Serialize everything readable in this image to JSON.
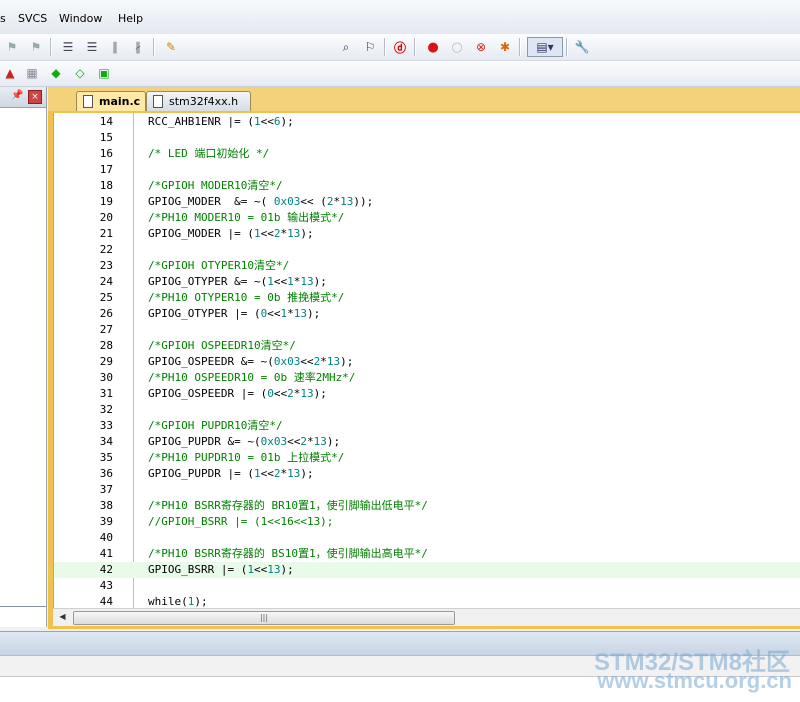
{
  "menu": [
    "s",
    "SVCS",
    "Window",
    "Help"
  ],
  "colors": {
    "comment": "#008000",
    "number": "#008080",
    "highlight": "#e8fbe8",
    "tab_active": "#ffe9a8"
  },
  "tabs": [
    {
      "label": "main.c",
      "active": true
    },
    {
      "label": "stm32f4xx.h",
      "active": false
    }
  ],
  "toolbar": {
    "find_value": "",
    "icons": [
      "indent-icon",
      "unindent-icon",
      "comment-icon",
      "uncomment-icon",
      "find-in-files-icon",
      "find-icon",
      "debug-icon",
      "breakpoint-icon",
      "disable-breakpoint-icon",
      "clear-breakpoints-icon",
      "kill-breakpoints-icon",
      "window-icon",
      "configure-icon"
    ]
  },
  "code": [
    {
      "n": "14",
      "parts": [
        [
          "t",
          "RCC_AHB1ENR |= ("
        ],
        [
          "n",
          "1"
        ],
        [
          "t",
          "<<"
        ],
        [
          "n",
          "6"
        ],
        [
          "t",
          ");"
        ]
      ]
    },
    {
      "n": "15",
      "parts": []
    },
    {
      "n": "16",
      "parts": [
        [
          "c",
          "/* LED 端口初始化 */"
        ]
      ]
    },
    {
      "n": "17",
      "parts": []
    },
    {
      "n": "18",
      "parts": [
        [
          "c",
          "/*GPIOH MODER10清空*/"
        ]
      ]
    },
    {
      "n": "19",
      "parts": [
        [
          "t",
          "GPIOG_MODER  &= ~( "
        ],
        [
          "n",
          "0x03"
        ],
        [
          "t",
          "<< ("
        ],
        [
          "n",
          "2"
        ],
        [
          "t",
          "*"
        ],
        [
          "n",
          "13"
        ],
        [
          "t",
          "));"
        ]
      ]
    },
    {
      "n": "20",
      "parts": [
        [
          "c",
          "/*PH10 MODER10 = 01b 输出模式*/"
        ]
      ]
    },
    {
      "n": "21",
      "parts": [
        [
          "t",
          "GPIOG_MODER |= ("
        ],
        [
          "n",
          "1"
        ],
        [
          "t",
          "<<"
        ],
        [
          "n",
          "2"
        ],
        [
          "t",
          "*"
        ],
        [
          "n",
          "13"
        ],
        [
          "t",
          ");"
        ]
      ]
    },
    {
      "n": "22",
      "parts": []
    },
    {
      "n": "23",
      "parts": [
        [
          "c",
          "/*GPIOH OTYPER10清空*/"
        ]
      ]
    },
    {
      "n": "24",
      "parts": [
        [
          "t",
          "GPIOG_OTYPER &= ~("
        ],
        [
          "n",
          "1"
        ],
        [
          "t",
          "<<"
        ],
        [
          "n",
          "1"
        ],
        [
          "t",
          "*"
        ],
        [
          "n",
          "13"
        ],
        [
          "t",
          ");"
        ]
      ]
    },
    {
      "n": "25",
      "parts": [
        [
          "c",
          "/*PH10 OTYPER10 = 0b 推挽模式*/"
        ]
      ]
    },
    {
      "n": "26",
      "parts": [
        [
          "t",
          "GPIOG_OTYPER |= ("
        ],
        [
          "n",
          "0"
        ],
        [
          "t",
          "<<"
        ],
        [
          "n",
          "1"
        ],
        [
          "t",
          "*"
        ],
        [
          "n",
          "13"
        ],
        [
          "t",
          ");"
        ]
      ]
    },
    {
      "n": "27",
      "parts": []
    },
    {
      "n": "28",
      "parts": [
        [
          "c",
          "/*GPIOH OSPEEDR10清空*/"
        ]
      ]
    },
    {
      "n": "29",
      "parts": [
        [
          "t",
          "GPIOG_OSPEEDR &= ~("
        ],
        [
          "n",
          "0x03"
        ],
        [
          "t",
          "<<"
        ],
        [
          "n",
          "2"
        ],
        [
          "t",
          "*"
        ],
        [
          "n",
          "13"
        ],
        [
          "t",
          ");"
        ]
      ]
    },
    {
      "n": "30",
      "parts": [
        [
          "c",
          "/*PH10 OSPEEDR10 = 0b 速率2MHz*/"
        ]
      ]
    },
    {
      "n": "31",
      "parts": [
        [
          "t",
          "GPIOG_OSPEEDR |= ("
        ],
        [
          "n",
          "0"
        ],
        [
          "t",
          "<<"
        ],
        [
          "n",
          "2"
        ],
        [
          "t",
          "*"
        ],
        [
          "n",
          "13"
        ],
        [
          "t",
          ");"
        ]
      ]
    },
    {
      "n": "32",
      "parts": []
    },
    {
      "n": "33",
      "parts": [
        [
          "c",
          "/*GPIOH PUPDR10清空*/"
        ]
      ]
    },
    {
      "n": "34",
      "parts": [
        [
          "t",
          "GPIOG_PUPDR &= ~("
        ],
        [
          "n",
          "0x03"
        ],
        [
          "t",
          "<<"
        ],
        [
          "n",
          "2"
        ],
        [
          "t",
          "*"
        ],
        [
          "n",
          "13"
        ],
        [
          "t",
          ");"
        ]
      ]
    },
    {
      "n": "35",
      "parts": [
        [
          "c",
          "/*PH10 PUPDR10 = 01b 上拉模式*/"
        ]
      ]
    },
    {
      "n": "36",
      "parts": [
        [
          "t",
          "GPIOG_PUPDR |= ("
        ],
        [
          "n",
          "1"
        ],
        [
          "t",
          "<<"
        ],
        [
          "n",
          "2"
        ],
        [
          "t",
          "*"
        ],
        [
          "n",
          "13"
        ],
        [
          "t",
          ");"
        ]
      ]
    },
    {
      "n": "37",
      "parts": []
    },
    {
      "n": "38",
      "parts": [
        [
          "c",
          "/*PH10 BSRR寄存器的 BR10置1，使引脚输出低电平*/"
        ]
      ]
    },
    {
      "n": "39",
      "parts": [
        [
          "c",
          "//GPIOH_BSRR |= (1<<16<<13);"
        ]
      ]
    },
    {
      "n": "40",
      "parts": []
    },
    {
      "n": "41",
      "parts": [
        [
          "c",
          "/*PH10 BSRR寄存器的 BS10置1，使引脚输出高电平*/"
        ]
      ]
    },
    {
      "n": "42",
      "parts": [
        [
          "t",
          "GPIOG_BSRR |= ("
        ],
        [
          "n",
          "1"
        ],
        [
          "t",
          "<<"
        ],
        [
          "n",
          "13"
        ],
        [
          "t",
          ");"
        ]
      ],
      "highlight": true
    },
    {
      "n": "43",
      "parts": []
    },
    {
      "n": "44",
      "parts": [
        [
          "t",
          "while("
        ],
        [
          "n",
          "1"
        ],
        [
          "t",
          ");"
        ]
      ]
    }
  ],
  "watermark": {
    "line1": "STM32/STM8社区",
    "line2": "www.stmcu.org.cn"
  }
}
